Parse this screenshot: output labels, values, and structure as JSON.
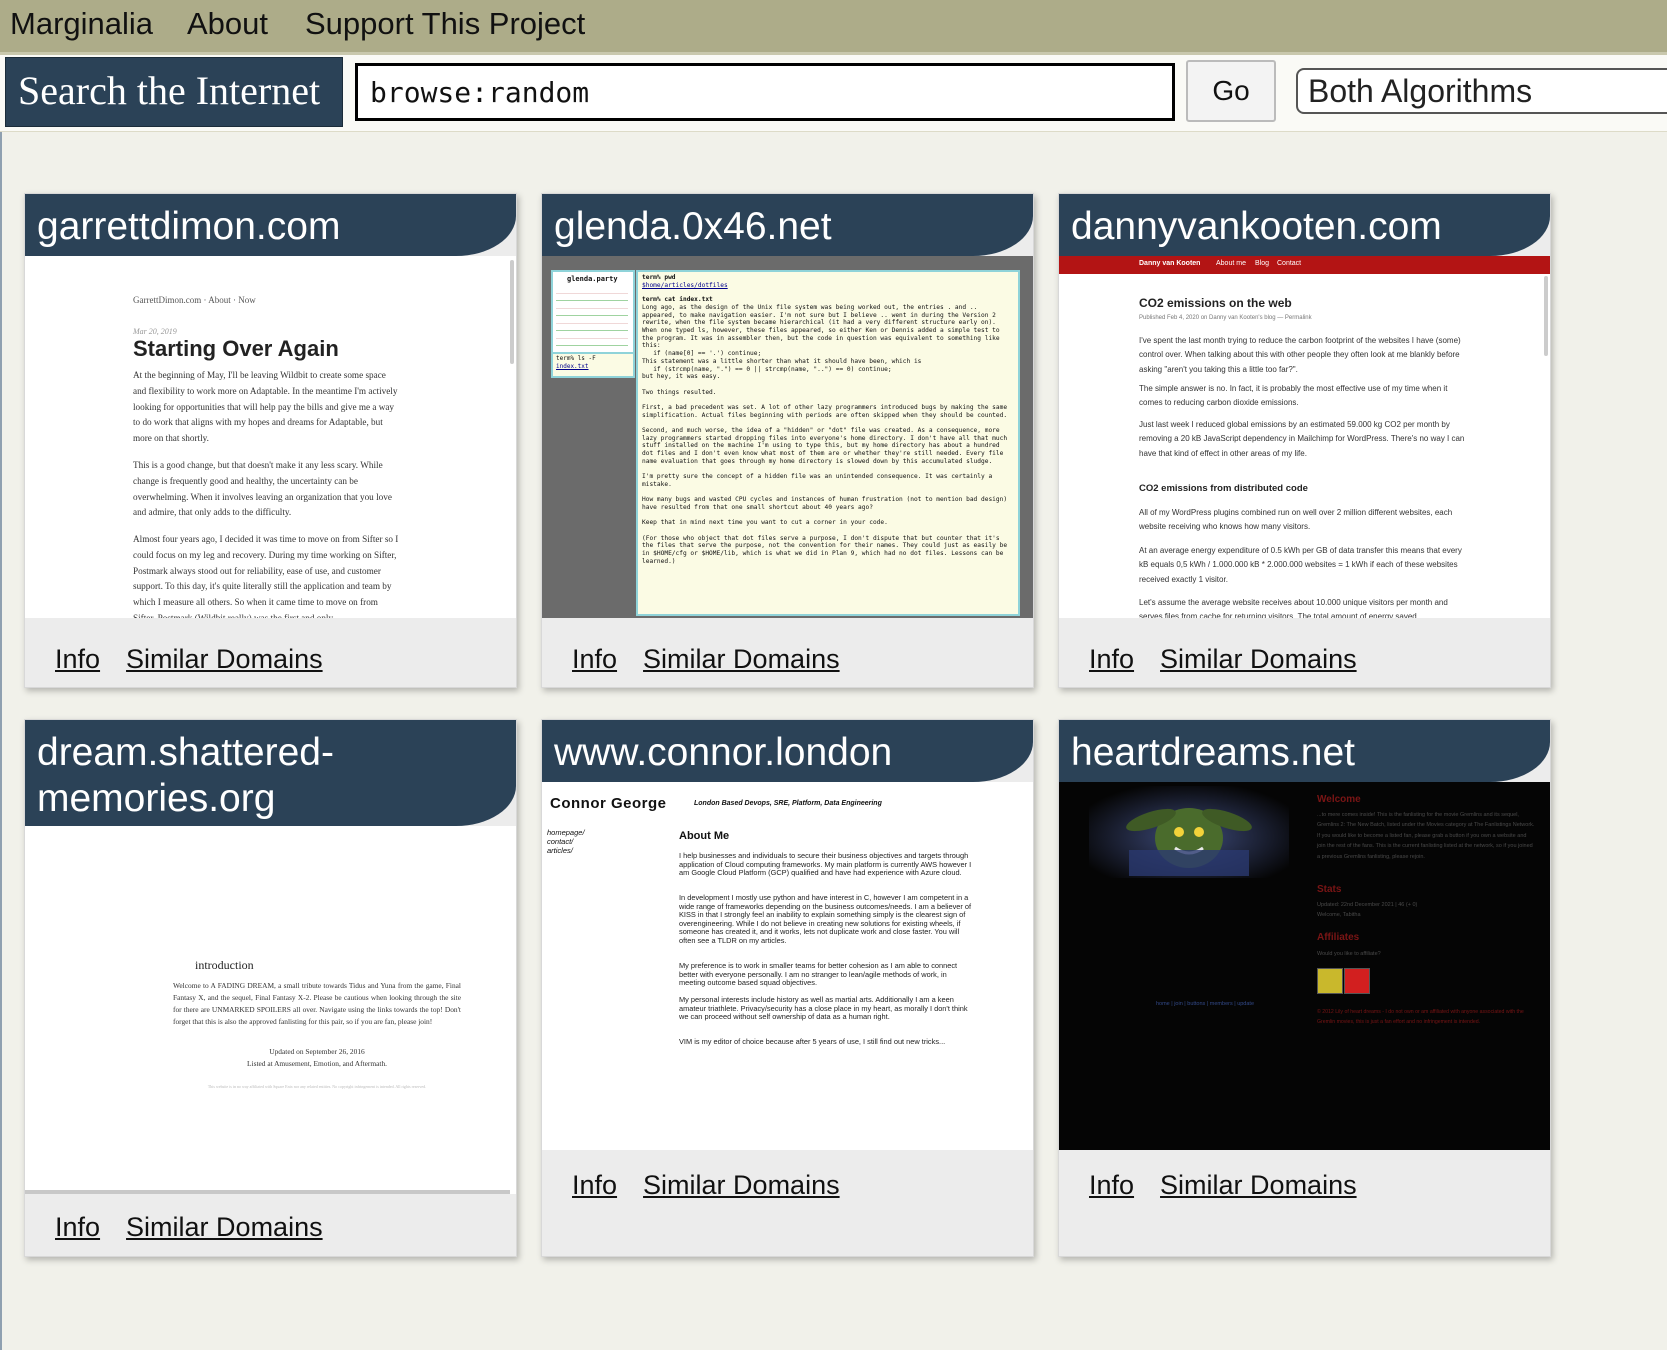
{
  "nav": {
    "items": [
      "Marginalia",
      "About",
      "Support This Project"
    ]
  },
  "search": {
    "label": "Search the Internet",
    "value": "browse:random",
    "go_label": "Go",
    "algorithm": "Both Algorithms"
  },
  "cards": [
    {
      "domain": "garrettdimon.com",
      "info": "Info",
      "similar": "Similar Domains",
      "shot": {
        "nav": "GarrettDimon.com · About · Now",
        "date": "Mar 20, 2019",
        "title": "Starting Over Again",
        "p1": "At the beginning of May, I'll be leaving Wildbit to create some space and flexibility to work more on Adaptable. In the meantime I'm actively looking for opportunities that will help pay the bills and give me a way to do work that aligns with my hopes and dreams for Adaptable, but more on that shortly.",
        "p2": "This is a good change, but that doesn't make it any less scary. While change is frequently good and healthy, the uncertainty can be overwhelming. When it involves leaving an organization that you love and admire, that only adds to the difficulty.",
        "p3": "Almost four years ago, I decided it was time to move on from Sifter so I could focus on my leg and recovery. During my time working on Sifter, Postmark always stood out for reliability, ease of use, and customer support. To this day, it's quite literally still the application and team by which I measure all others. So when it came time to move on from Sifter, Postmark (Wildbit really) was the first and only"
      }
    },
    {
      "domain": "glenda.0x46.net",
      "info": "Info",
      "similar": "Similar Domains",
      "shot": {
        "side_title": "glenda.party",
        "side_cmd": "term% ls -F",
        "side_link": "index.txt",
        "cmd1": "term% pwd",
        "path": "$home/articles/dotfiles",
        "cmd2": "term% cat index.txt",
        "body": "Long ago, as the design of the Unix file system was being worked out, the entries . and .. appeared, to make navigation easier. I'm not sure but I believe .. went in during the Version 2 rewrite, when the file system became hierarchical (it had a very different structure early on). When one typed ls, however, these files appeared, so either Ken or Dennis added a simple test to the program. It was in assembler then, but the code in question was equivalent to something like this:\n   if (name[0] == '.') continue;\nThis statement was a little shorter than what it should have been, which is\n   if (strcmp(name, \".\") == 0 || strcmp(name, \"..\") == 0) continue;\nbut hey, it was easy.\n\nTwo things resulted.\n\nFirst, a bad precedent was set. A lot of other lazy programmers introduced bugs by making the same simplification. Actual files beginning with periods are often skipped when they should be counted.\n\nSecond, and much worse, the idea of a \"hidden\" or \"dot\" file was created. As a consequence, more lazy programmers started dropping files into everyone's home directory. I don't have all that much stuff installed on the machine I'm using to type this, but my home directory has about a hundred dot files and I don't even know what most of them are or whether they're still needed. Every file name evaluation that goes through my home directory is slowed down by this accumulated sludge.\n\nI'm pretty sure the concept of a hidden file was an unintended consequence. It was certainly a mistake.\n\nHow many bugs and wasted CPU cycles and instances of human frustration (not to mention bad design) have resulted from that one small shortcut about 40 years ago?\n\nKeep that in mind next time you want to cut a corner in your code.\n\n(For those who object that dot files serve a purpose, I don't dispute that but counter that it's the files that serve the purpose, not the convention for their names. They could just as easily be in $HOME/cfg or $HOME/lib, which is what we did in Plan 9, which had no dot files. Lessons can be learned.)"
      }
    },
    {
      "domain": "dannyvankooten.com",
      "info": "Info",
      "similar": "Similar Domains",
      "shot": {
        "nav": [
          "Danny van Kooten",
          "About me",
          "Blog",
          "Contact"
        ],
        "title": "CO2 emissions on the web",
        "meta": "Published Feb 4, 2020 on Danny van Kooten's blog — Permalink",
        "p1": "I've spent the last month trying to reduce the carbon footprint of the websites I have (some) control over. When talking about this with other people they often look at me blankly before asking \"aren't you taking this a little too far?\".",
        "p2": "The simple answer is no. In fact, it is probably the most effective use of my time when it comes to reducing carbon dioxide emissions.",
        "p3": "Just last week I reduced global emissions by an estimated 59.000 kg CO2 per month by removing a 20 kB JavaScript dependency in Mailchimp for WordPress. There's no way I can have that kind of effect in other areas of my life.",
        "h2": "CO2 emissions from distributed code",
        "p4": "All of my WordPress plugins combined run on well over 2 million different websites, each website receiving who knows how many visitors.",
        "p5": "At an average energy expenditure of 0.5 kWh per GB of data transfer this means that every kB equals 0,5 kWh / 1.000.000 kB * 2.000.000 websites = 1 kWh if each of these websites received exactly 1 visitor.",
        "p6": "Let's assume the average website receives about 10.000 unique visitors per month and serves files from cache for returning visitors. The total amount of energy saved"
      }
    },
    {
      "domain": "dream.shattered-memories.org",
      "info": "Info",
      "similar": "Similar Domains",
      "shot": {
        "heading": "introduction",
        "p1": "Welcome to A FADING DREAM, a small tribute towards Tidus and Yuna from the game, Final Fantasy X, and the sequel, Final Fantasy X-2. Please be cautious when looking through the site for there are UNMARKED SPOILERS all over. Navigate using the links towards the top! Don't forget that this is also the approved fanlisting for this pair, so if you are fan, please join!",
        "updated": "Updated on September 26, 2016",
        "listed": "Listed at Amusement, Emotion, and Aftermath.",
        "footer": "This website is in no way affiliated with Square Enix nor any related entities. No copyright infringement is intended. All rights reserved."
      }
    },
    {
      "domain": "www.connor.london",
      "info": "Info",
      "similar": "Similar Domains",
      "shot": {
        "name": "Connor George",
        "tagline": "London Based Devops, SRE, Platform, Data Engineering",
        "links": [
          "homepage/",
          "contact/",
          "articles/"
        ],
        "title": "About Me",
        "p1": "I help businesses and individuals to secure their business objectives and targets through application of Cloud computing frameworks. My main platform is currently AWS however I am Google Cloud Platform (GCP) qualified and have had experience with Azure cloud.",
        "p2": "In development I mostly use python and have interest in C, however I am competent in a wide range of frameworks depending on the business outcomes/needs. I am a believer of KISS in that I strongly feel an inability to explain something simply is the clearest sign of overengineering. While I do not believe in creating new solutions for existing wheels, if someone has created it, and it works, lets not duplicate work and close faster. You will often see a TLDR on my articles.",
        "p3": "My preference is to work in smaller teams for better cohesion as I am able to connect better with everyone personally. I am no stranger to lean/agile methods of work, in meeting outcome based squad objectives.",
        "p4": "My personal interests include history as well as martial arts. Additionally I am a keen amateur triathlete. Privacy/security has a close place in my heart, as morally I don't think we can proceed without self ownership of data as a human right.",
        "p5": "VIM is my editor of choice because after 5 years of use, I still find out new tricks..."
      }
    },
    {
      "domain": "heartdreams.net",
      "info": "Info",
      "similar": "Similar Domains",
      "shot": {
        "welcome": "Welcome",
        "welcome_text": "...to mere comes inside! This is the fanlisting for the movie Gremlins and its sequel, Gremlins 2: The New Batch, listed under the Movies category at The Fanlistings Network. If you would like to become a listed fan, please grab a button if you own a website and join the rest of the fans. This is the current fanlisting listed at the network, so if you joined a previous Gremlins fanlisting, please rejoin.",
        "stats": "Stats",
        "stats_text": "Updated: 22nd December 2021 | 46 (+ 0)\nWelcome, Tabitha",
        "affiliates": "Affiliates",
        "affiliates_text": "Would you like to affiliate?",
        "nav": "home | join | buttons | members | update",
        "footer": "© 2012 Lily of heart dreams - I do not own or am affiliated with anyone associated with the Gremlin movies, this is just a fan effort and no infringement is intended."
      }
    }
  ],
  "colors": {
    "nav_bg": "#adac89",
    "header_bg": "#2b4257",
    "card_bg": "#ececec",
    "page_bg": "#f1f1ea"
  }
}
